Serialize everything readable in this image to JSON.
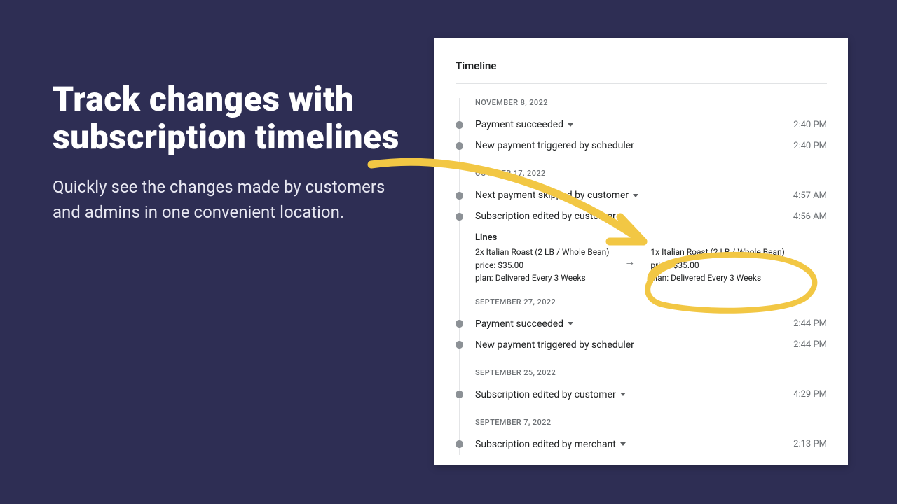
{
  "hero": {
    "title": "Track changes with subscription timelines",
    "subtitle": "Quickly see the changes made by customers and admins in one convenient location."
  },
  "card": {
    "title": "Timeline"
  },
  "sections": [
    {
      "date": "NOVEMBER 8, 2022",
      "items": [
        {
          "label": "Payment succeeded",
          "time": "2:40 PM",
          "expandable": true,
          "expanded": false
        },
        {
          "label": "New payment triggered by scheduler",
          "time": "2:40 PM",
          "expandable": false
        }
      ]
    },
    {
      "date": "OCTOBER 17, 2022",
      "items": [
        {
          "label": "Next payment skipped by customer",
          "time": "4:57 AM",
          "expandable": true,
          "expanded": false
        },
        {
          "label": "Subscription edited by customer",
          "time": "4:56 AM",
          "expandable": true,
          "expanded": true
        }
      ]
    },
    {
      "date": "SEPTEMBER 27, 2022",
      "items": [
        {
          "label": "Payment succeeded",
          "time": "2:44 PM",
          "expandable": true,
          "expanded": false
        },
        {
          "label": "New payment triggered by scheduler",
          "time": "2:44 PM",
          "expandable": false
        }
      ]
    },
    {
      "date": "SEPTEMBER 25, 2022",
      "items": [
        {
          "label": "Subscription edited by customer",
          "time": "4:29 PM",
          "expandable": true,
          "expanded": false
        }
      ]
    },
    {
      "date": "SEPTEMBER 7, 2022",
      "items": [
        {
          "label": "Subscription edited by merchant",
          "time": "2:13 PM",
          "expandable": true,
          "expanded": false
        }
      ]
    }
  ],
  "detail": {
    "header": "Lines",
    "before": {
      "line": "2x Italian Roast (2 LB / Whole Bean)",
      "price": "price: $35.00",
      "plan": "plan: Delivered Every 3 Weeks"
    },
    "after": {
      "line": "1x Italian Roast (2 LB / Whole Bean)",
      "price": "price: $35.00",
      "plan": "plan: Delivered Every 3 Weeks"
    }
  },
  "annotation_color": "#f2c744"
}
